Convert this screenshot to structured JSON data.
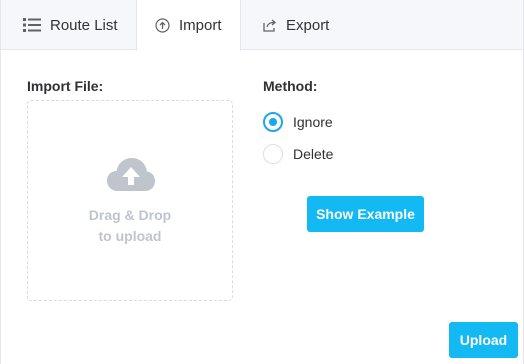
{
  "tabs": [
    {
      "label": "Route List",
      "icon": "list-icon",
      "active": false
    },
    {
      "label": "Import",
      "icon": "upload-circle-icon",
      "active": true
    },
    {
      "label": "Export",
      "icon": "share-icon",
      "active": false
    }
  ],
  "import": {
    "file_label": "Import File:",
    "dropzone": {
      "icon": "cloud-upload-icon",
      "line1": "Drag & Drop",
      "line2": "to upload"
    }
  },
  "method": {
    "label": "Method:",
    "options": [
      {
        "label": "Ignore",
        "selected": true
      },
      {
        "label": "Delete",
        "selected": false
      }
    ]
  },
  "buttons": {
    "show_example": "Show Example",
    "upload": "Upload"
  },
  "colors": {
    "accent": "#13b9f2",
    "radio_selected": "#1ba7ec",
    "tab_bar_bg": "#f5f7fa",
    "dropzone_text": "#c0c4cc"
  }
}
